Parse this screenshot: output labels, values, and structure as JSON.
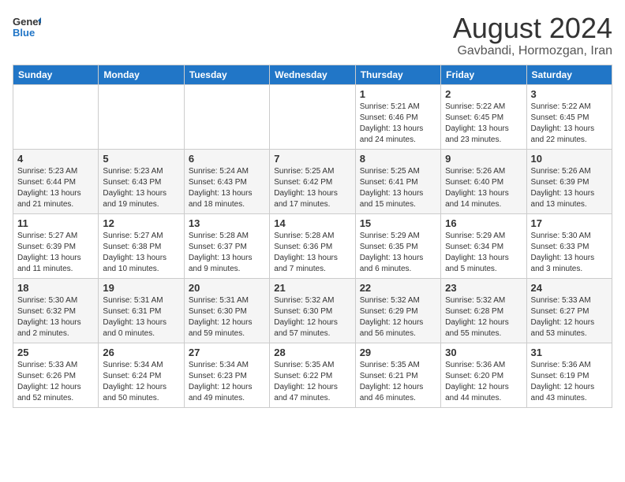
{
  "logo": {
    "line1": "General",
    "line2": "Blue"
  },
  "title": "August 2024",
  "subtitle": "Gavbandi, Hormozgan, Iran",
  "days_of_week": [
    "Sunday",
    "Monday",
    "Tuesday",
    "Wednesday",
    "Thursday",
    "Friday",
    "Saturday"
  ],
  "weeks": [
    [
      {
        "day": "",
        "info": ""
      },
      {
        "day": "",
        "info": ""
      },
      {
        "day": "",
        "info": ""
      },
      {
        "day": "",
        "info": ""
      },
      {
        "day": "1",
        "info": "Sunrise: 5:21 AM\nSunset: 6:46 PM\nDaylight: 13 hours\nand 24 minutes."
      },
      {
        "day": "2",
        "info": "Sunrise: 5:22 AM\nSunset: 6:45 PM\nDaylight: 13 hours\nand 23 minutes."
      },
      {
        "day": "3",
        "info": "Sunrise: 5:22 AM\nSunset: 6:45 PM\nDaylight: 13 hours\nand 22 minutes."
      }
    ],
    [
      {
        "day": "4",
        "info": "Sunrise: 5:23 AM\nSunset: 6:44 PM\nDaylight: 13 hours\nand 21 minutes."
      },
      {
        "day": "5",
        "info": "Sunrise: 5:23 AM\nSunset: 6:43 PM\nDaylight: 13 hours\nand 19 minutes."
      },
      {
        "day": "6",
        "info": "Sunrise: 5:24 AM\nSunset: 6:43 PM\nDaylight: 13 hours\nand 18 minutes."
      },
      {
        "day": "7",
        "info": "Sunrise: 5:25 AM\nSunset: 6:42 PM\nDaylight: 13 hours\nand 17 minutes."
      },
      {
        "day": "8",
        "info": "Sunrise: 5:25 AM\nSunset: 6:41 PM\nDaylight: 13 hours\nand 15 minutes."
      },
      {
        "day": "9",
        "info": "Sunrise: 5:26 AM\nSunset: 6:40 PM\nDaylight: 13 hours\nand 14 minutes."
      },
      {
        "day": "10",
        "info": "Sunrise: 5:26 AM\nSunset: 6:39 PM\nDaylight: 13 hours\nand 13 minutes."
      }
    ],
    [
      {
        "day": "11",
        "info": "Sunrise: 5:27 AM\nSunset: 6:39 PM\nDaylight: 13 hours\nand 11 minutes."
      },
      {
        "day": "12",
        "info": "Sunrise: 5:27 AM\nSunset: 6:38 PM\nDaylight: 13 hours\nand 10 minutes."
      },
      {
        "day": "13",
        "info": "Sunrise: 5:28 AM\nSunset: 6:37 PM\nDaylight: 13 hours\nand 9 minutes."
      },
      {
        "day": "14",
        "info": "Sunrise: 5:28 AM\nSunset: 6:36 PM\nDaylight: 13 hours\nand 7 minutes."
      },
      {
        "day": "15",
        "info": "Sunrise: 5:29 AM\nSunset: 6:35 PM\nDaylight: 13 hours\nand 6 minutes."
      },
      {
        "day": "16",
        "info": "Sunrise: 5:29 AM\nSunset: 6:34 PM\nDaylight: 13 hours\nand 5 minutes."
      },
      {
        "day": "17",
        "info": "Sunrise: 5:30 AM\nSunset: 6:33 PM\nDaylight: 13 hours\nand 3 minutes."
      }
    ],
    [
      {
        "day": "18",
        "info": "Sunrise: 5:30 AM\nSunset: 6:32 PM\nDaylight: 13 hours\nand 2 minutes."
      },
      {
        "day": "19",
        "info": "Sunrise: 5:31 AM\nSunset: 6:31 PM\nDaylight: 13 hours\nand 0 minutes."
      },
      {
        "day": "20",
        "info": "Sunrise: 5:31 AM\nSunset: 6:30 PM\nDaylight: 12 hours\nand 59 minutes."
      },
      {
        "day": "21",
        "info": "Sunrise: 5:32 AM\nSunset: 6:30 PM\nDaylight: 12 hours\nand 57 minutes."
      },
      {
        "day": "22",
        "info": "Sunrise: 5:32 AM\nSunset: 6:29 PM\nDaylight: 12 hours\nand 56 minutes."
      },
      {
        "day": "23",
        "info": "Sunrise: 5:32 AM\nSunset: 6:28 PM\nDaylight: 12 hours\nand 55 minutes."
      },
      {
        "day": "24",
        "info": "Sunrise: 5:33 AM\nSunset: 6:27 PM\nDaylight: 12 hours\nand 53 minutes."
      }
    ],
    [
      {
        "day": "25",
        "info": "Sunrise: 5:33 AM\nSunset: 6:26 PM\nDaylight: 12 hours\nand 52 minutes."
      },
      {
        "day": "26",
        "info": "Sunrise: 5:34 AM\nSunset: 6:24 PM\nDaylight: 12 hours\nand 50 minutes."
      },
      {
        "day": "27",
        "info": "Sunrise: 5:34 AM\nSunset: 6:23 PM\nDaylight: 12 hours\nand 49 minutes."
      },
      {
        "day": "28",
        "info": "Sunrise: 5:35 AM\nSunset: 6:22 PM\nDaylight: 12 hours\nand 47 minutes."
      },
      {
        "day": "29",
        "info": "Sunrise: 5:35 AM\nSunset: 6:21 PM\nDaylight: 12 hours\nand 46 minutes."
      },
      {
        "day": "30",
        "info": "Sunrise: 5:36 AM\nSunset: 6:20 PM\nDaylight: 12 hours\nand 44 minutes."
      },
      {
        "day": "31",
        "info": "Sunrise: 5:36 AM\nSunset: 6:19 PM\nDaylight: 12 hours\nand 43 minutes."
      }
    ]
  ]
}
